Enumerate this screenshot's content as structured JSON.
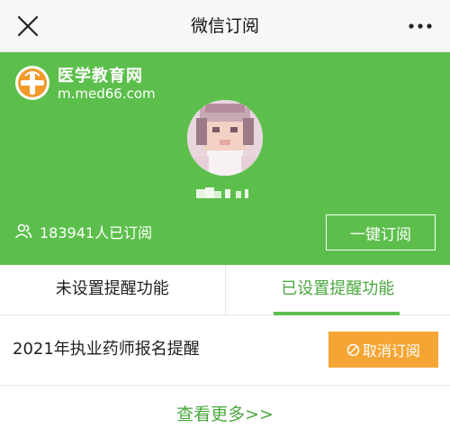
{
  "nav": {
    "title": "微信订阅",
    "close_icon": "close-icon",
    "more_icon": "more-icon"
  },
  "hero": {
    "logo_title": "医学教育网",
    "logo_url": "m.med66.com",
    "subscriber_text": "183941人已订阅",
    "subscribe_button": "一键订阅",
    "colors": {
      "background": "#5cbf4c",
      "logo_orange": "#f39a2a"
    }
  },
  "tabs": [
    {
      "label": "未设置提醒功能",
      "active": false
    },
    {
      "label": "已设置提醒功能",
      "active": true
    }
  ],
  "reminders": [
    {
      "title": "2021年执业药师报名提醒",
      "action": "取消订阅"
    }
  ],
  "more_link": "查看更多>>",
  "colors": {
    "accent_green": "#4aa83e",
    "cancel_orange": "#f5a533"
  }
}
